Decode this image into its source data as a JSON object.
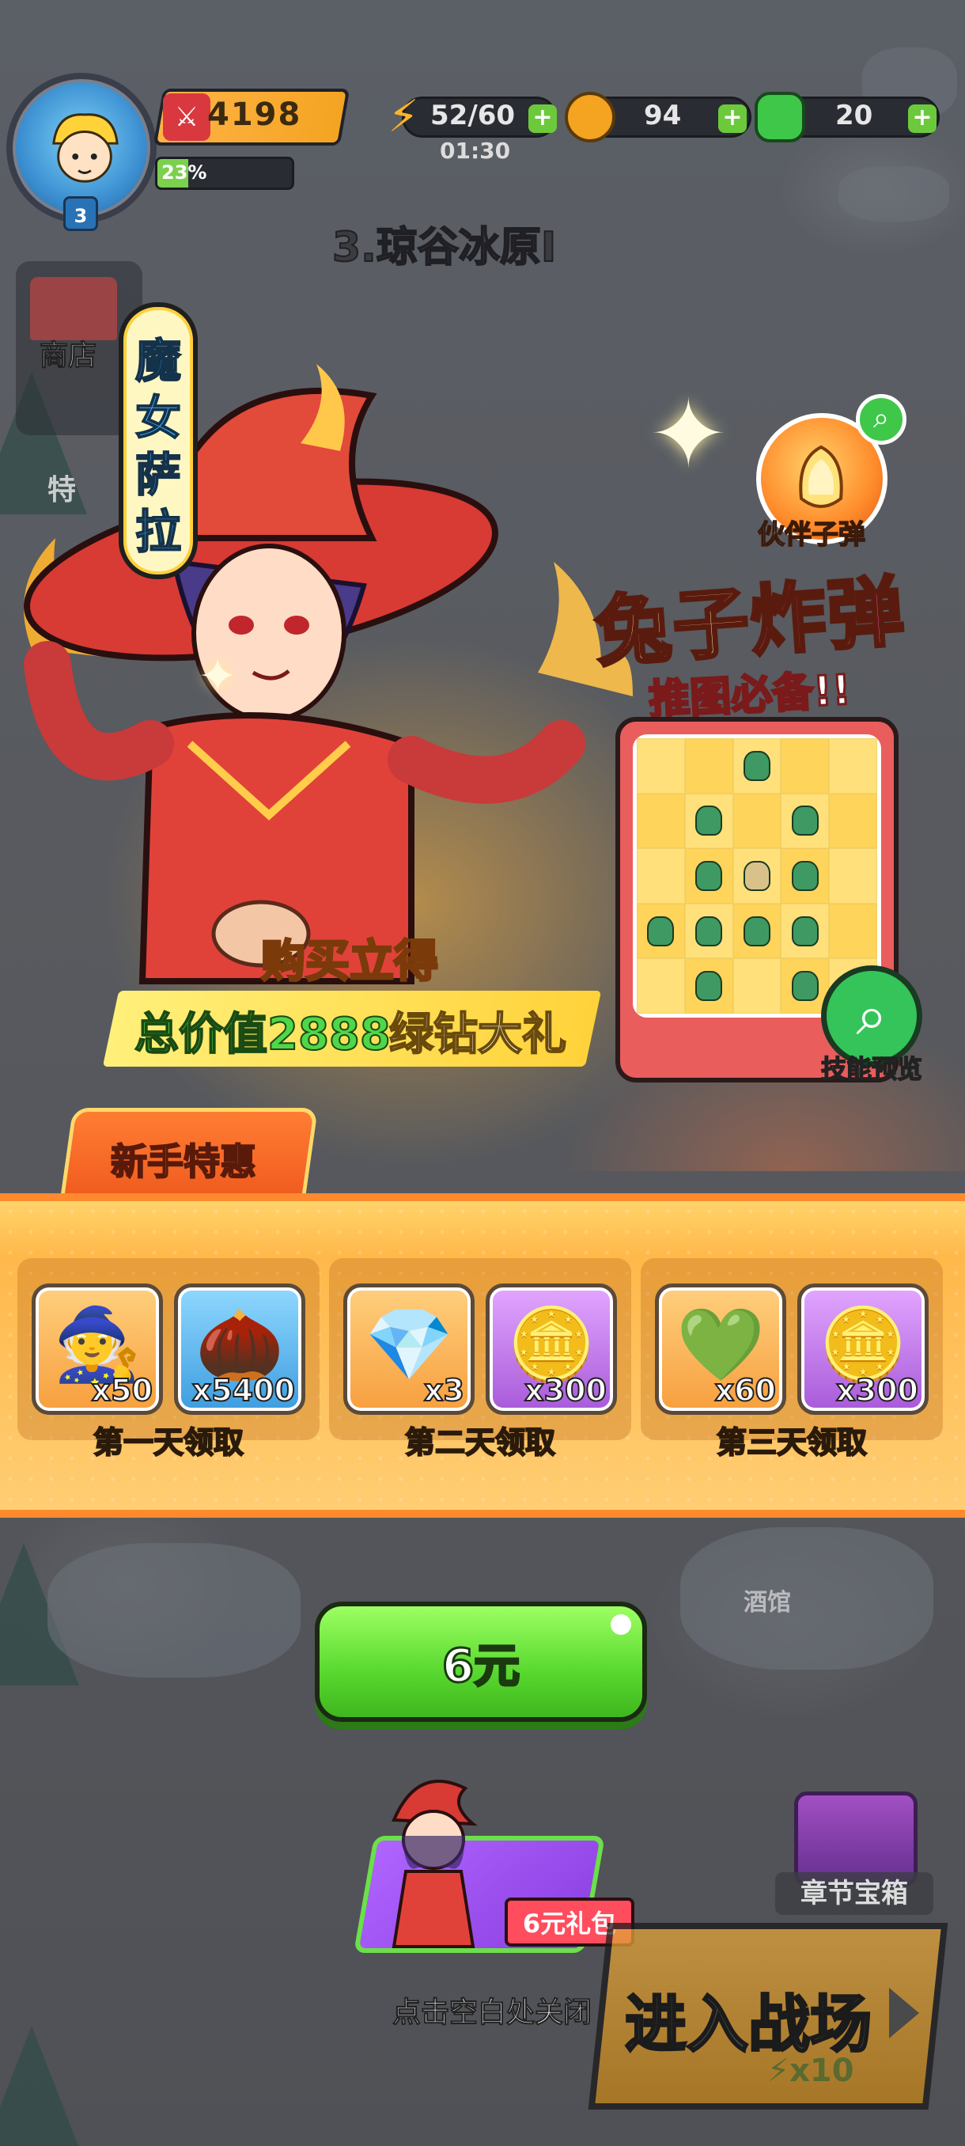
{
  "hud": {
    "player_level": "3",
    "power": "4198",
    "exp_percent_text": "23%",
    "exp_fraction": 0.23,
    "energy": "52/60",
    "energy_timer": "01:30",
    "coins": "94",
    "gems": "20",
    "plus": "+"
  },
  "stage": {
    "title": "3.琼谷冰原I"
  },
  "side": {
    "shop_label": "商店",
    "special_label": "特"
  },
  "background": {
    "tavern_label": "酒馆"
  },
  "promo": {
    "hero_name_chars": [
      "魔",
      "女",
      "萨",
      "拉"
    ],
    "partner_label": "伙伴子弹",
    "bomb_title_a": "兔子",
    "bomb_title_b": "炸弹",
    "bomb_subtitle": "推图必备!!",
    "skill_preview_label": "技能预览",
    "buy_now": "购买立得",
    "value_text_a": "总价值2888",
    "value_text_b": "绿钻大礼"
  },
  "offer": {
    "tab_label": "新手特惠",
    "days": [
      {
        "label": "第一天领取",
        "items": [
          {
            "icon": "hero-fragment-icon",
            "qty": "x50",
            "style": "orange",
            "glyph": "🧙"
          },
          {
            "icon": "acorn-icon",
            "qty": "x5400",
            "style": "blue",
            "glyph": "🌰"
          }
        ]
      },
      {
        "label": "第二天领取",
        "items": [
          {
            "icon": "purple-crystal-icon",
            "qty": "x3",
            "style": "orange",
            "glyph": "💎"
          },
          {
            "icon": "gold-coin-icon",
            "qty": "x300",
            "style": "purple",
            "glyph": "🪙"
          }
        ]
      },
      {
        "label": "第三天领取",
        "items": [
          {
            "icon": "green-gem-icon",
            "qty": "x60",
            "style": "orange",
            "glyph": "💚"
          },
          {
            "icon": "gold-coin-icon",
            "qty": "x300",
            "style": "purple",
            "glyph": "🪙"
          }
        ]
      }
    ],
    "price_button_label": "6元"
  },
  "bottom": {
    "pack_tag_label": "6元礼包",
    "close_hint": "点击空白处关闭",
    "chest_label": "章节宝箱",
    "battle_label": "进入战场",
    "battle_cost": "x10"
  },
  "colors": {
    "accent_green": "#58d82e",
    "accent_orange": "#ff8a2e",
    "accent_pink": "#ff5ab8"
  }
}
